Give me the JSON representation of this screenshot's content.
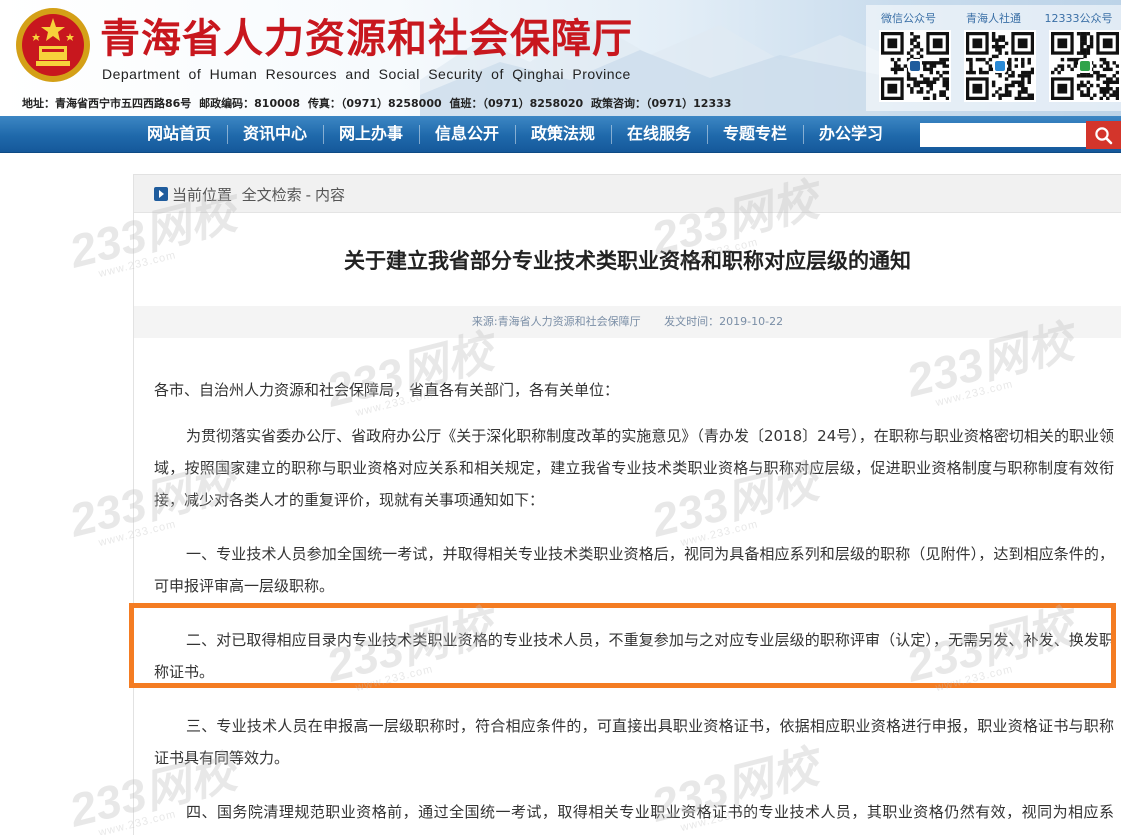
{
  "header": {
    "title_cn": "青海省人力资源和社会保障厅",
    "title_en": "Department of Human Resources and Social Security of Qinghai Province",
    "address": "地址：青海省西宁市五四西路86号",
    "postcode": "邮政编码：810008",
    "fax": "传真：（0971）8258000",
    "duty": "值班：（0971）8258020",
    "policy": "政策咨询：（0971）12333",
    "qr_codes": [
      {
        "label": "微信公众号"
      },
      {
        "label": "青海人社通"
      },
      {
        "label": "12333公众号"
      }
    ]
  },
  "nav": {
    "items": [
      "网站首页",
      "资讯中心",
      "网上办事",
      "信息公开",
      "政策法规",
      "在线服务",
      "专题专栏",
      "办公学习"
    ],
    "search_placeholder": ""
  },
  "breadcrumb": {
    "label": "当前位置",
    "path1": "全文检索",
    "sep": "-",
    "path2": "内容"
  },
  "article": {
    "title": "关于建立我省部分专业技术类职业资格和职称对应层级的通知",
    "source": "来源:青海省人力资源和社会保障厅",
    "date": "发文时间：2019-10-22",
    "salutation": "各市、自治州人力资源和社会保障局，省直各有关部门，各有关单位：",
    "p1": "为贯彻落实省委办公厅、省政府办公厅《关于深化职称制度改革的实施意见》（青办发〔2018〕24号），在职称与职业资格密切相关的职业领域，按照国家建立的职称与职业资格对应关系和相关规定，建立我省专业技术类职业资格与职称对应层级，促进职业资格制度与职称制度有效衔接，减少对各类人才的重复评价，现就有关事项通知如下：",
    "p2": "一、专业技术人员参加全国统一考试，并取得相关专业技术类职业资格后，视同为具备相应系列和层级的职称（见附件），达到相应条件的，可申报评审高一层级职称。",
    "p3": "二、对已取得相应目录内专业技术类职业资格的专业技术人员，不重复参加与之对应专业层级的职称评审（认定），无需另发、补发、换发职称证书。",
    "p4": "三、专业技术人员在申报高一层级职称时，符合相应条件的，可直接出具职业资格证书，依据相应职业资格进行申报，职业资格证书与职称证书具有同等效力。",
    "p5": "四、国务院清理规范职业资格前，通过全国统一考试，取得相关专业职业资格证书的专业技术人员，其职业资格仍然有效，视同为相应系列、相应专业、相应层级的职称。"
  },
  "watermark": {
    "text": "233网校",
    "sub": "www.233.com"
  },
  "colors": {
    "title_red": "#c8171e",
    "nav_blue": "#1f69ab",
    "search_red": "#d3352b",
    "highlight_orange": "#f47c22",
    "meta_text": "#7a8ea6"
  }
}
